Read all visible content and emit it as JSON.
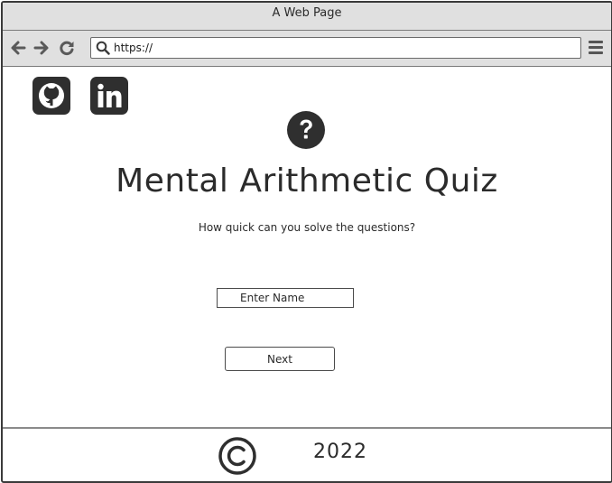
{
  "window": {
    "title": "A Web Page"
  },
  "toolbar": {
    "back_icon": "arrow-left-icon",
    "forward_icon": "arrow-right-icon",
    "reload_icon": "reload-icon",
    "url": "https://",
    "menu_icon": "hamburger-menu-icon"
  },
  "header": {
    "social_links": [
      {
        "icon": "github-icon"
      },
      {
        "icon": "linkedin-icon"
      }
    ]
  },
  "main": {
    "hero_icon": "question-mark-icon",
    "title": "Mental Arithmetic Quiz",
    "subtitle": "How quick can you solve the questions?",
    "name_input": {
      "placeholder": "Enter Name",
      "value": ""
    },
    "next_label": "Next"
  },
  "footer": {
    "icon": "copyright-icon",
    "year": "2022"
  },
  "colors": {
    "chrome_bg": "#e0e0e0",
    "icon_dark": "#2f2f2f",
    "text": "#2b2b2b",
    "border": "#3a3a3a"
  }
}
